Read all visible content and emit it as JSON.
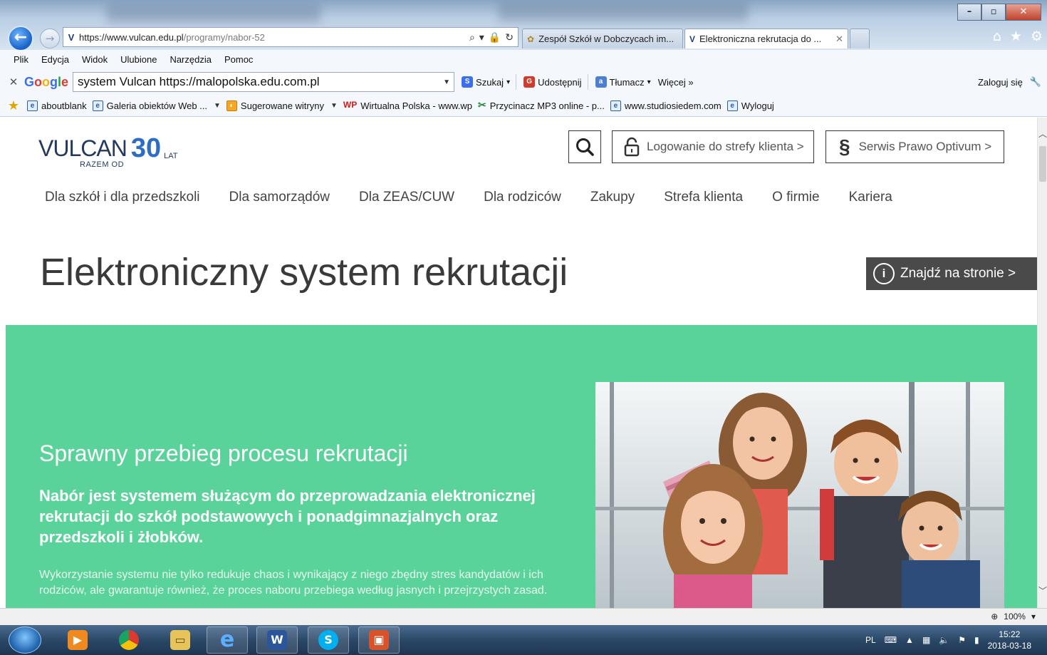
{
  "browser": {
    "address_url_host": "https://www.vulcan.edu.pl",
    "address_url_path": "/programy/nabor-52",
    "tabs": [
      {
        "title": "Zespół Szkół w Dobczycach im...",
        "active": false
      },
      {
        "title": "Elektroniczna rekrutacja do ...",
        "active": true
      }
    ],
    "menu": [
      "Plik",
      "Edycja",
      "Widok",
      "Ulubione",
      "Narzędzia",
      "Pomoc"
    ],
    "google_toolbar": {
      "search_value": "system Vulcan https://malopolska.edu.com.pl",
      "search_label": "Szukaj",
      "share_label": "Udostępnij",
      "translate_label": "Tłumacz",
      "more_label": "Więcej »",
      "login_label": "Zaloguj się"
    },
    "favorites": [
      {
        "label": "aboutblank",
        "icon": "ie-page-icon"
      },
      {
        "label": "Galeria obiektów Web ...",
        "icon": "ie-page-icon"
      },
      {
        "label": "Sugerowane witryny",
        "icon": "suggested-sites-icon"
      },
      {
        "label": "Wirtualna Polska - www.wp",
        "icon": "wp-icon"
      },
      {
        "label": "Przycinacz MP3 online - p...",
        "icon": "mp3-cutter-icon"
      },
      {
        "label": "www.studiosiedem.com",
        "icon": "ie-page-icon"
      },
      {
        "label": "Wyloguj",
        "icon": "ie-page-icon"
      }
    ],
    "zoom": "100%"
  },
  "site": {
    "logo_brand": "VULCAN",
    "logo_sub": "RAZEM OD",
    "logo_number": "30",
    "logo_unit": "LAT",
    "login_button": "Logowanie do strefy klienta >",
    "prawo_button": "Serwis Prawo Optivum >",
    "nav": [
      "Dla szkół i dla przedszkoli",
      "Dla samorządów",
      "Dla ZEAS/CUW",
      "Dla rodziców",
      "Zakupy",
      "Strefa klienta",
      "O firmie",
      "Kariera"
    ],
    "page_title": "Elektroniczny system rekrutacji",
    "find_button": "Znajdź na stronie >",
    "hero_heading": "Sprawny przebieg procesu rekrutacji",
    "hero_lead": "Nabór jest systemem służącym do przeprowadzania elektronicznej rekrutacji do szkół podstawowych i ponadgimnazjalnych oraz przedszkoli i żłobków.",
    "hero_body": "Wykorzystanie systemu nie tylko redukuje chaos i wynikający z niego zbędny stres kandydatów i ich rodziców, ale gwarantuje również, że proces naboru przebiega według jasnych i przejrzystych zasad.",
    "accent_green": "#5ad39b"
  },
  "taskbar": {
    "language": "PL",
    "time": "15:22",
    "date": "2018-03-18"
  }
}
